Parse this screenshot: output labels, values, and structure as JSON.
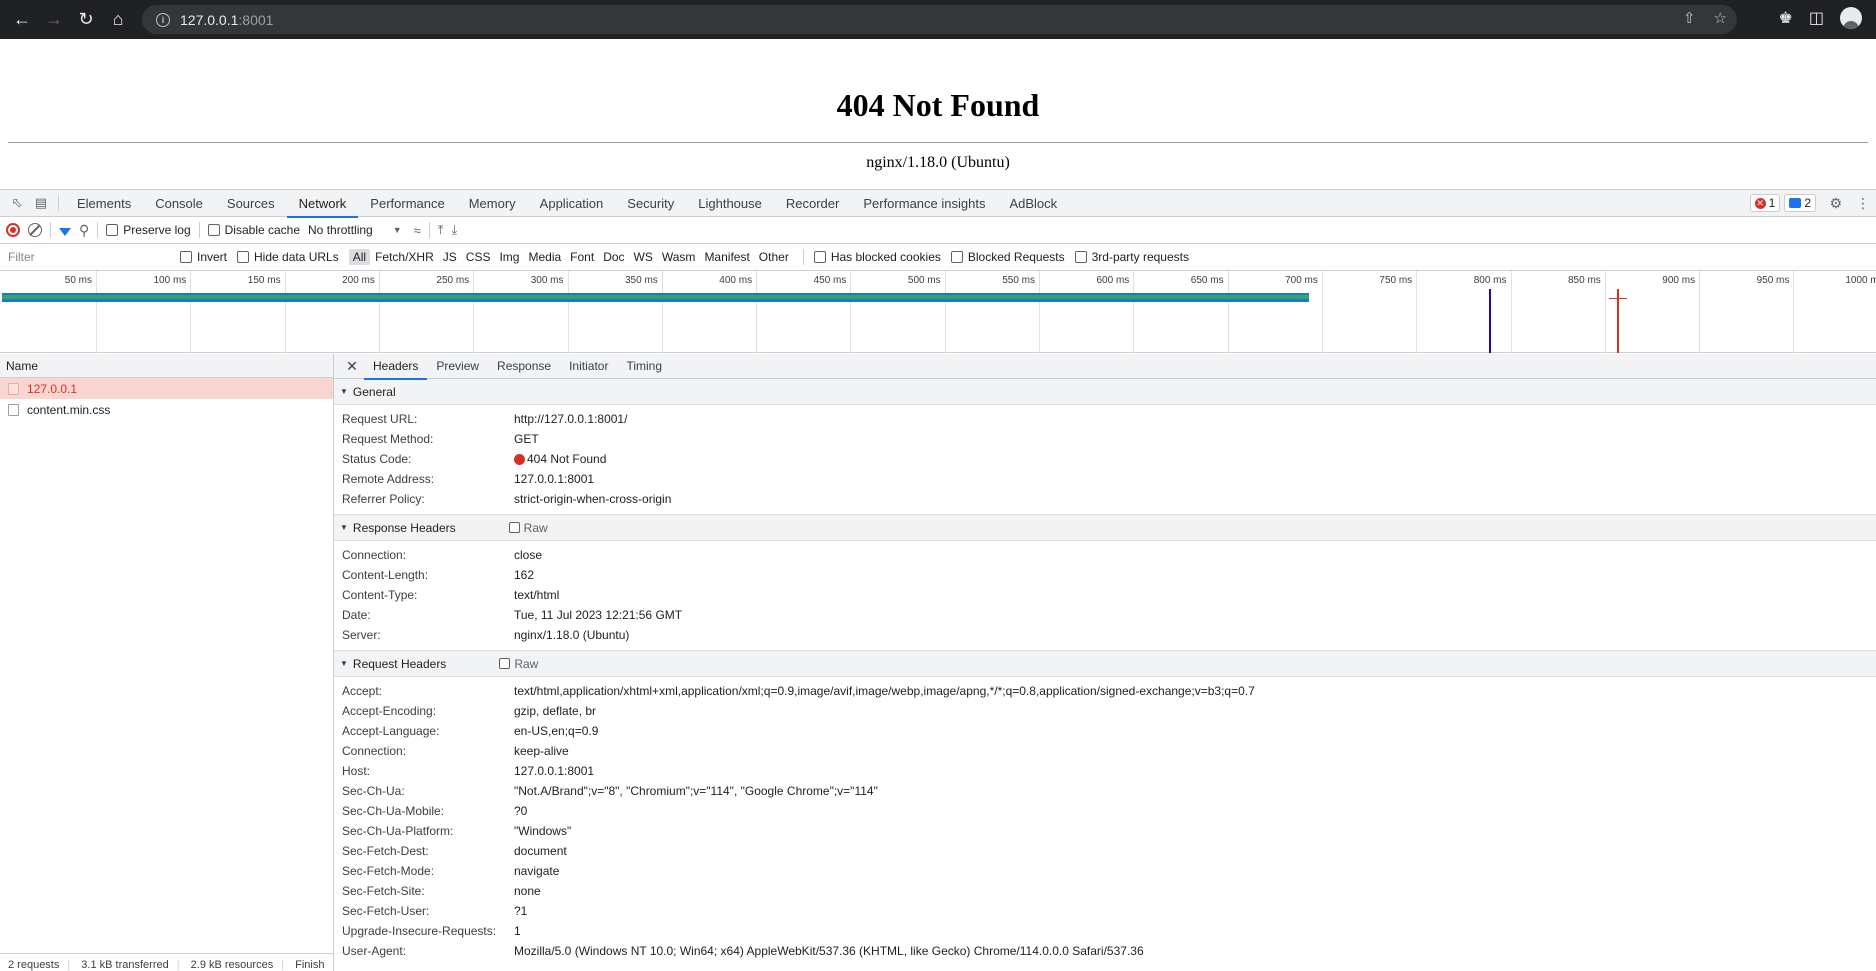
{
  "browser": {
    "url_host": "127.0.0.1",
    "url_port": ":8001"
  },
  "page": {
    "heading": "404 Not Found",
    "server": "nginx/1.18.0 (Ubuntu)"
  },
  "devtools": {
    "tabs": [
      "Elements",
      "Console",
      "Sources",
      "Network",
      "Performance",
      "Memory",
      "Application",
      "Security",
      "Lighthouse",
      "Recorder",
      "Performance insights",
      "AdBlock"
    ],
    "active_tab": "Network",
    "badge_errors": "1",
    "badge_messages": "2",
    "toolbar": {
      "preserve_log": "Preserve log",
      "disable_cache": "Disable cache",
      "throttling": "No throttling"
    },
    "filter": {
      "placeholder": "Filter",
      "invert": "Invert",
      "hide_data_urls": "Hide data URLs",
      "types": [
        "All",
        "Fetch/XHR",
        "JS",
        "CSS",
        "Img",
        "Media",
        "Font",
        "Doc",
        "WS",
        "Wasm",
        "Manifest",
        "Other"
      ],
      "has_blocked_cookies": "Has blocked cookies",
      "blocked_requests": "Blocked Requests",
      "third_party": "3rd-party requests"
    },
    "timeline": {
      "ticks": [
        "50 ms",
        "100 ms",
        "150 ms",
        "200 ms",
        "250 ms",
        "300 ms",
        "350 ms",
        "400 ms",
        "450 ms",
        "500 ms",
        "550 ms",
        "600 ms",
        "650 ms",
        "700 ms",
        "750 ms",
        "800 ms",
        "850 ms",
        "900 ms",
        "950 ms",
        "1000 ms"
      ]
    },
    "requests": {
      "column": "Name",
      "items": [
        "127.0.0.1",
        "content.min.css"
      ]
    },
    "statusbar": {
      "requests": "2 requests",
      "transferred": "3.1 kB transferred",
      "resources": "2.9 kB resources",
      "finish": "Finish"
    },
    "detail_tabs": [
      "Headers",
      "Preview",
      "Response",
      "Initiator",
      "Timing"
    ],
    "general": {
      "title": "General",
      "rows": [
        {
          "k": "Request URL:",
          "v": "http://127.0.0.1:8001/"
        },
        {
          "k": "Request Method:",
          "v": "GET"
        },
        {
          "k": "Status Code:",
          "v": "404 Not Found"
        },
        {
          "k": "Remote Address:",
          "v": "127.0.0.1:8001"
        },
        {
          "k": "Referrer Policy:",
          "v": "strict-origin-when-cross-origin"
        }
      ]
    },
    "response_headers": {
      "title": "Response Headers",
      "raw": "Raw",
      "rows": [
        {
          "k": "Connection:",
          "v": "close"
        },
        {
          "k": "Content-Length:",
          "v": "162"
        },
        {
          "k": "Content-Type:",
          "v": "text/html"
        },
        {
          "k": "Date:",
          "v": "Tue, 11 Jul 2023 12:21:56 GMT"
        },
        {
          "k": "Server:",
          "v": "nginx/1.18.0 (Ubuntu)"
        }
      ]
    },
    "request_headers": {
      "title": "Request Headers",
      "raw": "Raw",
      "rows": [
        {
          "k": "Accept:",
          "v": "text/html,application/xhtml+xml,application/xml;q=0.9,image/avif,image/webp,image/apng,*/*;q=0.8,application/signed-exchange;v=b3;q=0.7"
        },
        {
          "k": "Accept-Encoding:",
          "v": "gzip, deflate, br"
        },
        {
          "k": "Accept-Language:",
          "v": "en-US,en;q=0.9"
        },
        {
          "k": "Connection:",
          "v": "keep-alive"
        },
        {
          "k": "Host:",
          "v": "127.0.0.1:8001"
        },
        {
          "k": "Sec-Ch-Ua:",
          "v": "\"Not.A/Brand\";v=\"8\", \"Chromium\";v=\"114\", \"Google Chrome\";v=\"114\""
        },
        {
          "k": "Sec-Ch-Ua-Mobile:",
          "v": "?0"
        },
        {
          "k": "Sec-Ch-Ua-Platform:",
          "v": "\"Windows\""
        },
        {
          "k": "Sec-Fetch-Dest:",
          "v": "document"
        },
        {
          "k": "Sec-Fetch-Mode:",
          "v": "navigate"
        },
        {
          "k": "Sec-Fetch-Site:",
          "v": "none"
        },
        {
          "k": "Sec-Fetch-User:",
          "v": "?1"
        },
        {
          "k": "Upgrade-Insecure-Requests:",
          "v": "1"
        },
        {
          "k": "User-Agent:",
          "v": "Mozilla/5.0 (Windows NT 10.0; Win64; x64) AppleWebKit/537.36 (KHTML, like Gecko) Chrome/114.0.0.0 Safari/537.36"
        }
      ]
    }
  }
}
